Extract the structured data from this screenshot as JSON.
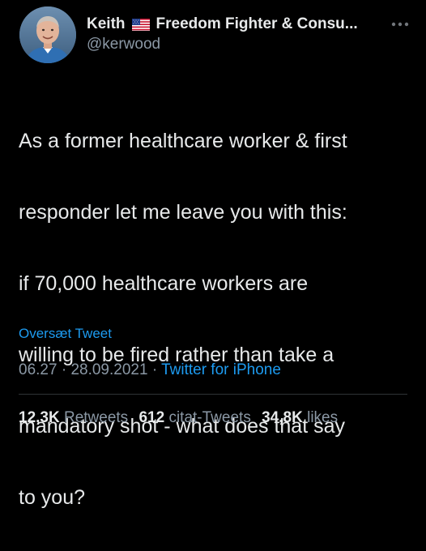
{
  "author": {
    "display_name": "Keith",
    "flag_icon": "us-flag-icon",
    "name_suffix": "Freedom Fighter & Consu...",
    "handle": "@kerwood",
    "avatar_icon": "profile-photo-avatar"
  },
  "more_icon": "more-options-icon",
  "tweet": {
    "lines": [
      "As a former healthcare worker & first",
      "responder let me leave you with this:",
      "if 70,000 healthcare workers are",
      "willing to be fired rather than take a",
      "mandatory shot - what does that say",
      "to you?"
    ],
    "translate_label": "Oversæt Tweet"
  },
  "meta": {
    "time": "06.27",
    "separator": "·",
    "date": "28.09.2021",
    "source": "Twitter for iPhone"
  },
  "stats": {
    "retweets_count": "12,3K",
    "retweets_label": "Retweets",
    "quotes_count": "612",
    "quotes_label": "citat-Tweets",
    "likes_count": "34,8K",
    "likes_label": "likes"
  },
  "colors": {
    "background": "#000000",
    "text_primary": "#e7e9ea",
    "text_secondary": "#8b98a5",
    "link": "#1d9bf0",
    "divider": "#2f3336"
  }
}
